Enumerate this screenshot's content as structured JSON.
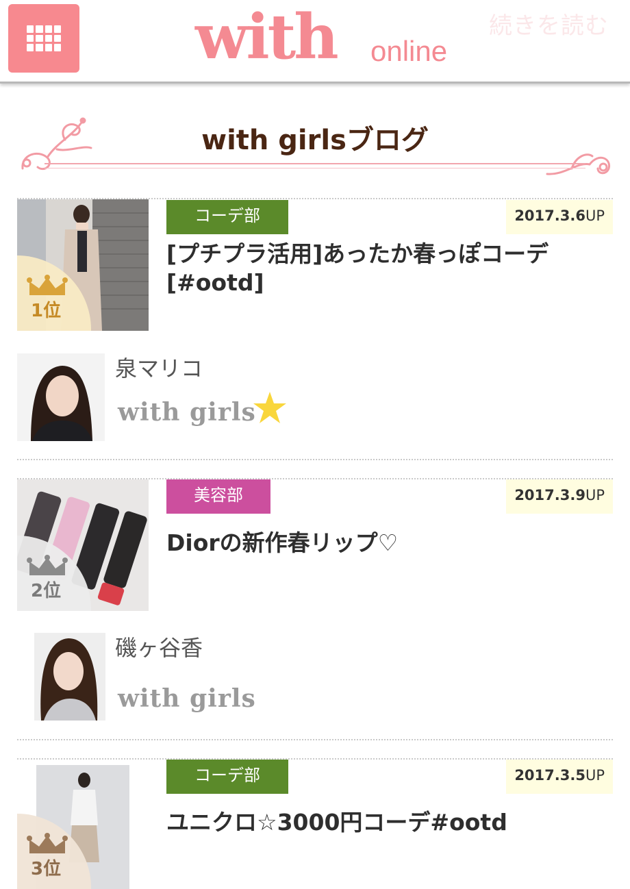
{
  "header": {
    "logo_main": "with",
    "logo_sub": "online",
    "read_more": "続きを読む"
  },
  "section": {
    "title": "with girlsブログ"
  },
  "entries": [
    {
      "category": "コーデ部",
      "category_color": "#5b8a2a",
      "date": "2017.3.6",
      "date_suffix": "UP",
      "title": "[プチプラ活用]あったか春っぽコーデ[#ootd]",
      "rank": "1位",
      "author": "泉マリコ",
      "badge": "with girls",
      "has_star": true
    },
    {
      "category": "美容部",
      "category_color": "#cc4f9e",
      "date": "2017.3.9",
      "date_suffix": "UP",
      "title": "Diorの新作春リップ♡",
      "rank": "2位",
      "author": "磯ヶ谷香",
      "badge": "with girls",
      "has_star": false
    },
    {
      "category": "コーデ部",
      "category_color": "#5b8a2a",
      "date": "2017.3.5",
      "date_suffix": "UP",
      "title": "ユニクロ☆3000円コーデ#ootd",
      "rank": "3位"
    }
  ],
  "colors": {
    "brand_pink": "#f48a92",
    "menu_button": "#f7898f",
    "title_brown": "#4a2613",
    "rank_gold": "#d9a33a",
    "rank_silver": "#8a8a8a",
    "rank_bronze": "#9c7a5a",
    "date_bg": "#fffde0"
  },
  "icons": [
    "grid-menu-icon",
    "crown-icon",
    "star-icon",
    "ornament-swirl-icon"
  ]
}
